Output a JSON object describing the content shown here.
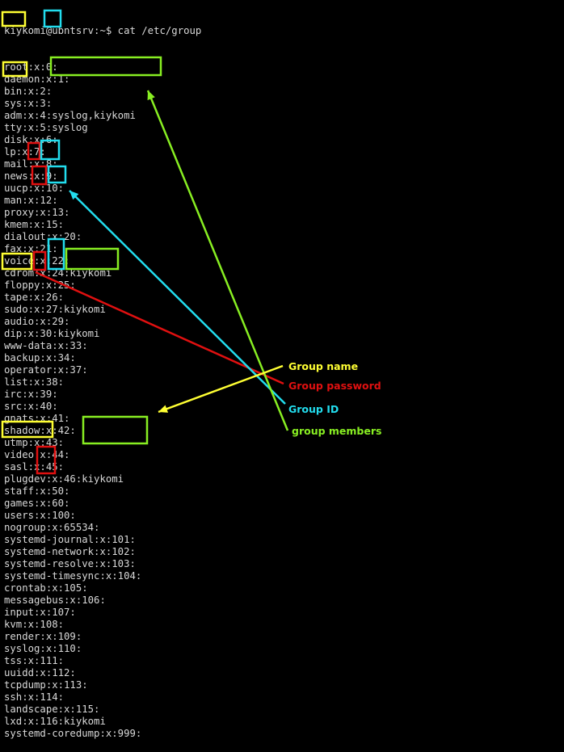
{
  "terminal": {
    "prompt": "kiykomi@ubntsrv:~$ cat /etc/group",
    "lines": [
      "root:x:0:",
      "daemon:x:1:",
      "bin:x:2:",
      "sys:x:3:",
      "adm:x:4:syslog,kiykomi",
      "tty:x:5:syslog",
      "disk:x:6:",
      "lp:x:7:",
      "mail:x:8:",
      "news:x:9:",
      "uucp:x:10:",
      "man:x:12:",
      "proxy:x:13:",
      "kmem:x:15:",
      "dialout:x:20:",
      "fax:x:21:",
      "voice:x:22:",
      "cdrom:x:24:kiykomi",
      "floppy:x:25:",
      "tape:x:26:",
      "sudo:x:27:kiykomi",
      "audio:x:29:",
      "dip:x:30:kiykomi",
      "www-data:x:33:",
      "backup:x:34:",
      "operator:x:37:",
      "list:x:38:",
      "irc:x:39:",
      "src:x:40:",
      "gnats:x:41:",
      "shadow:x:42:",
      "utmp:x:43:",
      "video:x:44:",
      "sasl:x:45:",
      "plugdev:x:46:kiykomi",
      "staff:x:50:",
      "games:x:60:",
      "users:x:100:",
      "nogroup:x:65534:",
      "systemd-journal:x:101:",
      "systemd-network:x:102:",
      "systemd-resolve:x:103:",
      "systemd-timesync:x:104:",
      "crontab:x:105:",
      "messagebus:x:106:",
      "input:x:107:",
      "kvm:x:108:",
      "render:x:109:",
      "syslog:x:110:",
      "tss:x:111:",
      "uuidd:x:112:",
      "tcpdump:x:113:",
      "ssh:x:114:",
      "landscape:x:115:",
      "lxd:x:116:kiykomi",
      "systemd-coredump:x:999:"
    ]
  },
  "legend": {
    "group_name": "Group name",
    "group_password": "Group password",
    "group_id": "Group ID",
    "group_members": "group members"
  },
  "colors": {
    "background": "#000000",
    "text": "#d8d8d8",
    "group_name": "#ffff33",
    "group_password": "#e01010",
    "group_id": "#22ddee",
    "group_members": "#88ee22"
  }
}
